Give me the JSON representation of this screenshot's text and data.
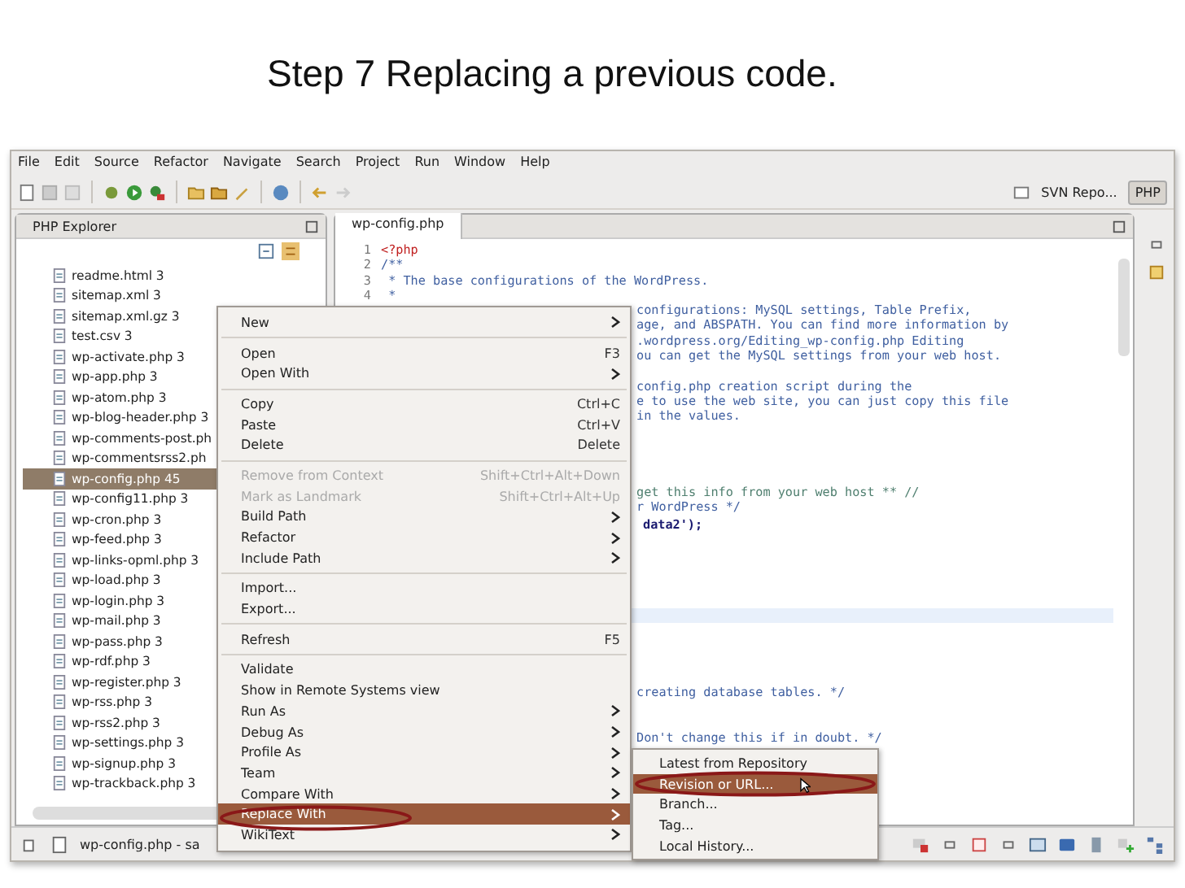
{
  "slide_title": "Step 7 Replacing a previous code.",
  "menu_bar": [
    "File",
    "Edit",
    "Source",
    "Refactor",
    "Navigate",
    "Search",
    "Project",
    "Run",
    "Window",
    "Help"
  ],
  "perspectives": [
    {
      "label": "SVN Repo...",
      "selected": false
    },
    {
      "label": "PHP",
      "selected": true
    }
  ],
  "explorer": {
    "title": "PHP Explorer",
    "items": [
      {
        "label": "readme.html 3",
        "selected": false
      },
      {
        "label": "sitemap.xml 3",
        "selected": false
      },
      {
        "label": "sitemap.xml.gz 3",
        "selected": false
      },
      {
        "label": "test.csv 3",
        "selected": false
      },
      {
        "label": "wp-activate.php 3",
        "selected": false
      },
      {
        "label": "wp-app.php 3",
        "selected": false
      },
      {
        "label": "wp-atom.php 3",
        "selected": false
      },
      {
        "label": "wp-blog-header.php 3",
        "selected": false
      },
      {
        "label": "wp-comments-post.ph",
        "selected": false
      },
      {
        "label": "wp-commentsrss2.ph",
        "selected": false
      },
      {
        "label": "wp-config.php 45",
        "selected": true
      },
      {
        "label": "wp-config11.php 3",
        "selected": false
      },
      {
        "label": "wp-cron.php 3",
        "selected": false
      },
      {
        "label": "wp-feed.php 3",
        "selected": false
      },
      {
        "label": "wp-links-opml.php 3",
        "selected": false
      },
      {
        "label": "wp-load.php 3",
        "selected": false
      },
      {
        "label": "wp-login.php 3",
        "selected": false
      },
      {
        "label": "wp-mail.php 3",
        "selected": false
      },
      {
        "label": "wp-pass.php 3",
        "selected": false
      },
      {
        "label": "wp-rdf.php 3",
        "selected": false
      },
      {
        "label": "wp-register.php 3",
        "selected": false
      },
      {
        "label": "wp-rss.php 3",
        "selected": false
      },
      {
        "label": "wp-rss2.php 3",
        "selected": false
      },
      {
        "label": "wp-settings.php 3",
        "selected": false
      },
      {
        "label": "wp-signup.php 3",
        "selected": false
      },
      {
        "label": "wp-trackback.php 3",
        "selected": false
      }
    ]
  },
  "editor": {
    "tab": "wp-config.php",
    "lines": [
      {
        "number": "1",
        "text": "<?php",
        "kind": "keyword"
      },
      {
        "number": "2",
        "text": "/**",
        "kind": "doc"
      },
      {
        "number": "3",
        "text": " * The base configurations of the WordPress.",
        "kind": "doc"
      },
      {
        "number": "4",
        "text": " *",
        "kind": "doc"
      },
      {
        "text": "configurations: MySQL settings, Table Prefix,",
        "kind": "doc"
      },
      {
        "text": "age, and ABSPATH. You can find more information by",
        "kind": "doc"
      },
      {
        "text": ".wordpress.org/Editing_wp-config.php Editing",
        "kind": "doc"
      },
      {
        "text": "ou can get the MySQL settings from your web host.",
        "kind": "doc"
      },
      {
        "kind": "blank"
      },
      {
        "text": "config.php creation script during the",
        "kind": "doc"
      },
      {
        "text": "e to use the web site, you can just copy this file",
        "kind": "doc"
      },
      {
        "text": "in the values.",
        "kind": "doc"
      },
      {
        "kind": "blank"
      },
      {
        "kind": "blank"
      },
      {
        "kind": "blank"
      },
      {
        "kind": "blank"
      },
      {
        "text": "get this info from your web host ** //",
        "kind": "comment"
      },
      {
        "text": "r WordPress */",
        "kind": "doc"
      },
      {
        "text": "data2');",
        "kind": "code"
      },
      {
        "kind": "blank"
      },
      {
        "kind": "blank"
      },
      {
        "kind": "blank"
      },
      {
        "kind": "blank"
      },
      {
        "kind": "blank"
      },
      {
        "kind": "current"
      },
      {
        "kind": "blank"
      },
      {
        "kind": "blank"
      },
      {
        "kind": "blank"
      },
      {
        "kind": "blank"
      },
      {
        "text": "creating database tables. */",
        "kind": "doc"
      },
      {
        "kind": "blank"
      },
      {
        "kind": "blank"
      },
      {
        "text": "Don't change this if in doubt. */",
        "kind": "doc"
      }
    ]
  },
  "context_menu": [
    [
      {
        "label": "New",
        "has_submenu": true,
        "disabled": false,
        "selected": false
      }
    ],
    [
      {
        "label": "Open",
        "shortcut": "F3",
        "has_submenu": false,
        "disabled": false,
        "selected": false
      },
      {
        "label": "Open With",
        "has_submenu": true,
        "disabled": false,
        "selected": false
      }
    ],
    [
      {
        "label": "Copy",
        "shortcut": "Ctrl+C",
        "has_submenu": false,
        "disabled": false,
        "selected": false
      },
      {
        "label": "Paste",
        "shortcut": "Ctrl+V",
        "has_submenu": false,
        "disabled": false,
        "selected": false
      },
      {
        "label": "Delete",
        "shortcut": "Delete",
        "has_submenu": false,
        "disabled": false,
        "selected": false
      }
    ],
    [
      {
        "label": "Remove from Context",
        "shortcut": "Shift+Ctrl+Alt+Down",
        "has_submenu": false,
        "disabled": true,
        "selected": false
      },
      {
        "label": "Mark as Landmark",
        "shortcut": "Shift+Ctrl+Alt+Up",
        "has_submenu": false,
        "disabled": true,
        "selected": false
      },
      {
        "label": "Build Path",
        "has_submenu": true,
        "disabled": false,
        "selected": false
      },
      {
        "label": "Refactor",
        "has_submenu": true,
        "disabled": false,
        "selected": false
      },
      {
        "label": "Include Path",
        "has_submenu": true,
        "disabled": false,
        "selected": false
      }
    ],
    [
      {
        "label": "Import...",
        "has_submenu": false,
        "disabled": false,
        "selected": false
      },
      {
        "label": "Export...",
        "has_submenu": false,
        "disabled": false,
        "selected": false
      }
    ],
    [
      {
        "label": "Refresh",
        "shortcut": "F5",
        "has_submenu": false,
        "disabled": false,
        "selected": false
      }
    ],
    [
      {
        "label": "Validate",
        "has_submenu": false,
        "disabled": false,
        "selected": false
      },
      {
        "label": "Show in Remote Systems view",
        "has_submenu": false,
        "disabled": false,
        "selected": false
      },
      {
        "label": "Run As",
        "has_submenu": true,
        "disabled": false,
        "selected": false
      },
      {
        "label": "Debug As",
        "has_submenu": true,
        "disabled": false,
        "selected": false
      },
      {
        "label": "Profile As",
        "has_submenu": true,
        "disabled": false,
        "selected": false
      },
      {
        "label": "Team",
        "has_submenu": true,
        "disabled": false,
        "selected": false
      },
      {
        "label": "Compare With",
        "has_submenu": true,
        "disabled": false,
        "selected": false
      },
      {
        "label": "Replace With",
        "has_submenu": true,
        "disabled": false,
        "selected": true
      },
      {
        "label": "WikiText",
        "has_submenu": true,
        "disabled": false,
        "selected": false
      }
    ]
  ],
  "submenu": [
    {
      "label": "Latest from Repository",
      "selected": false
    },
    {
      "label": "Revision or URL...",
      "selected": true
    },
    {
      "label": "Branch...",
      "selected": false
    },
    {
      "label": "Tag...",
      "selected": false
    },
    {
      "label": "Local History...",
      "selected": false
    }
  ],
  "status_bar": {
    "text": "wp-config.php - sa"
  }
}
